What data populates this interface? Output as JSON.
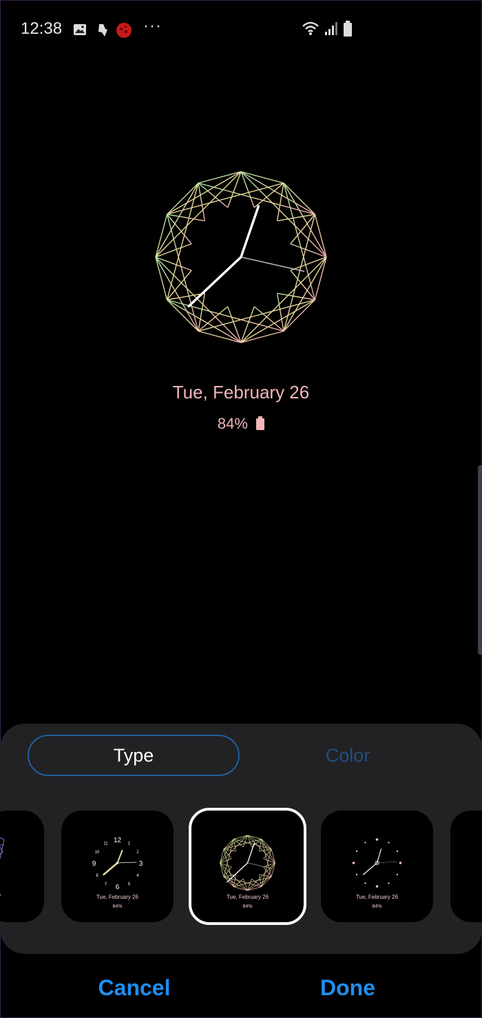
{
  "status_bar": {
    "time": "12:38",
    "more": "···",
    "icons": [
      "gallery-icon",
      "bixby-icon",
      "ladybug-icon",
      "wifi-icon",
      "signal-icon",
      "battery-icon"
    ]
  },
  "preview": {
    "date": "Tue, February 26",
    "battery": "84%"
  },
  "tabs": {
    "type_label": "Type",
    "color_label": "Color",
    "selected": "Type"
  },
  "thumbnails": [
    {
      "name": "partial-left",
      "style": "clock-style-geometric-purple"
    },
    {
      "name": "numeral",
      "style": "clock-style-numerals",
      "date": "Tue, February 26",
      "battery": "84%",
      "numerals": [
        "12",
        "11",
        "1",
        "10",
        "2",
        "9",
        "3",
        "8",
        "4",
        "7",
        "5",
        "6"
      ]
    },
    {
      "name": "geometric",
      "style": "clock-style-geometric",
      "date": "Tue, February 26",
      "battery": "84%",
      "selected": true
    },
    {
      "name": "dots",
      "style": "clock-style-dots",
      "date": "Tue, February 26",
      "battery": "84%"
    },
    {
      "name": "partial-right",
      "style": "clock-style-partial"
    }
  ],
  "partial_left_date": "y 26",
  "actions": {
    "cancel_label": "Cancel",
    "done_label": "Done"
  },
  "colors": {
    "accent": "#1e8ef0",
    "date_text": "#f2b7b7",
    "sheet_bg": "#222224"
  }
}
